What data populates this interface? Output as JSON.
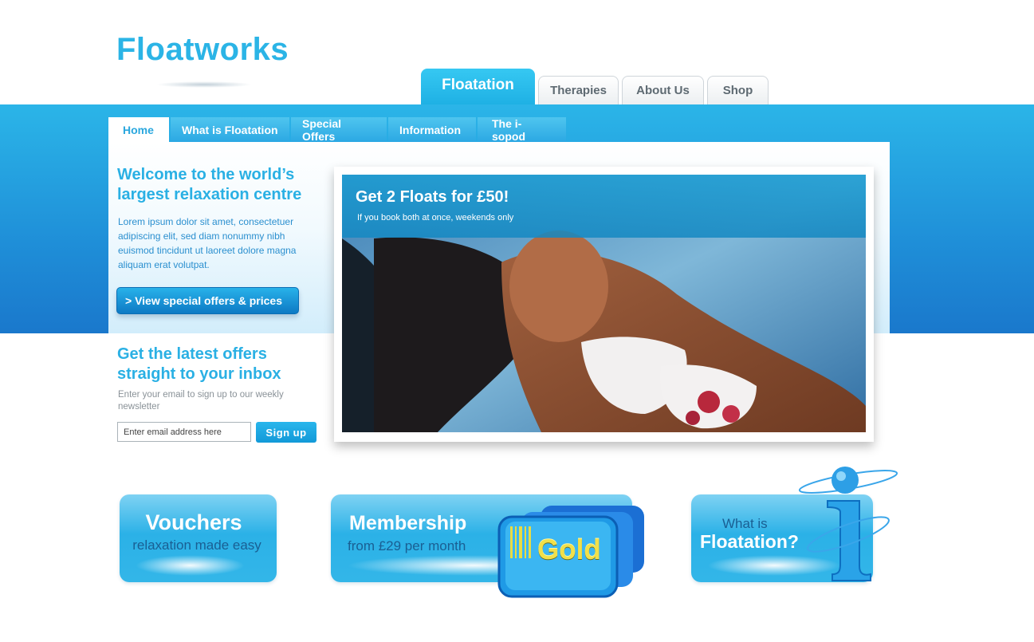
{
  "brand": {
    "logo": "Floatworks"
  },
  "main_nav": [
    {
      "label": "Floatation",
      "active": true
    },
    {
      "label": "Therapies",
      "active": false
    },
    {
      "label": "About Us",
      "active": false
    },
    {
      "label": "Shop",
      "active": false
    }
  ],
  "sub_nav": [
    {
      "label": "Home",
      "active": true
    },
    {
      "label": "What is Floatation",
      "active": false
    },
    {
      "label": "Special Offers",
      "active": false
    },
    {
      "label": "Information",
      "active": false
    },
    {
      "label": "The i-sopod",
      "active": false
    }
  ],
  "welcome": {
    "title": "Welcome to the world’s largest relaxation centre",
    "body": "Lorem ipsum dolor sit amet, consectetuer adipiscing elit, sed diam nonummy nibh euismod tincidunt ut laoreet dolore magna aliquam erat volutpat.",
    "cta": "> View special offers & prices"
  },
  "newsletter": {
    "title": "Get the latest offers straight to your inbox",
    "body": "Enter your email to sign up to our weekly newsletter",
    "placeholder": "Enter email address here",
    "button": "Sign up"
  },
  "hero": {
    "title": "Get 2 Floats for £50!",
    "subtitle": "If you book both at once, weekends only",
    "image": "woman-floating-in-water-photo"
  },
  "promos": {
    "vouchers": {
      "title": "Vouchers",
      "subtitle": "relaxation made easy"
    },
    "membership": {
      "title": "Membership",
      "subtitle": "from £29 per month",
      "badge": "Gold"
    },
    "floatation": {
      "pre": "What is",
      "title": "Floatation?"
    }
  },
  "colors": {
    "brand_blue": "#2bb4e6",
    "band_blue": "#1f8fd8",
    "text_blue": "#2a8fcf",
    "gold": "#f1e04a"
  }
}
